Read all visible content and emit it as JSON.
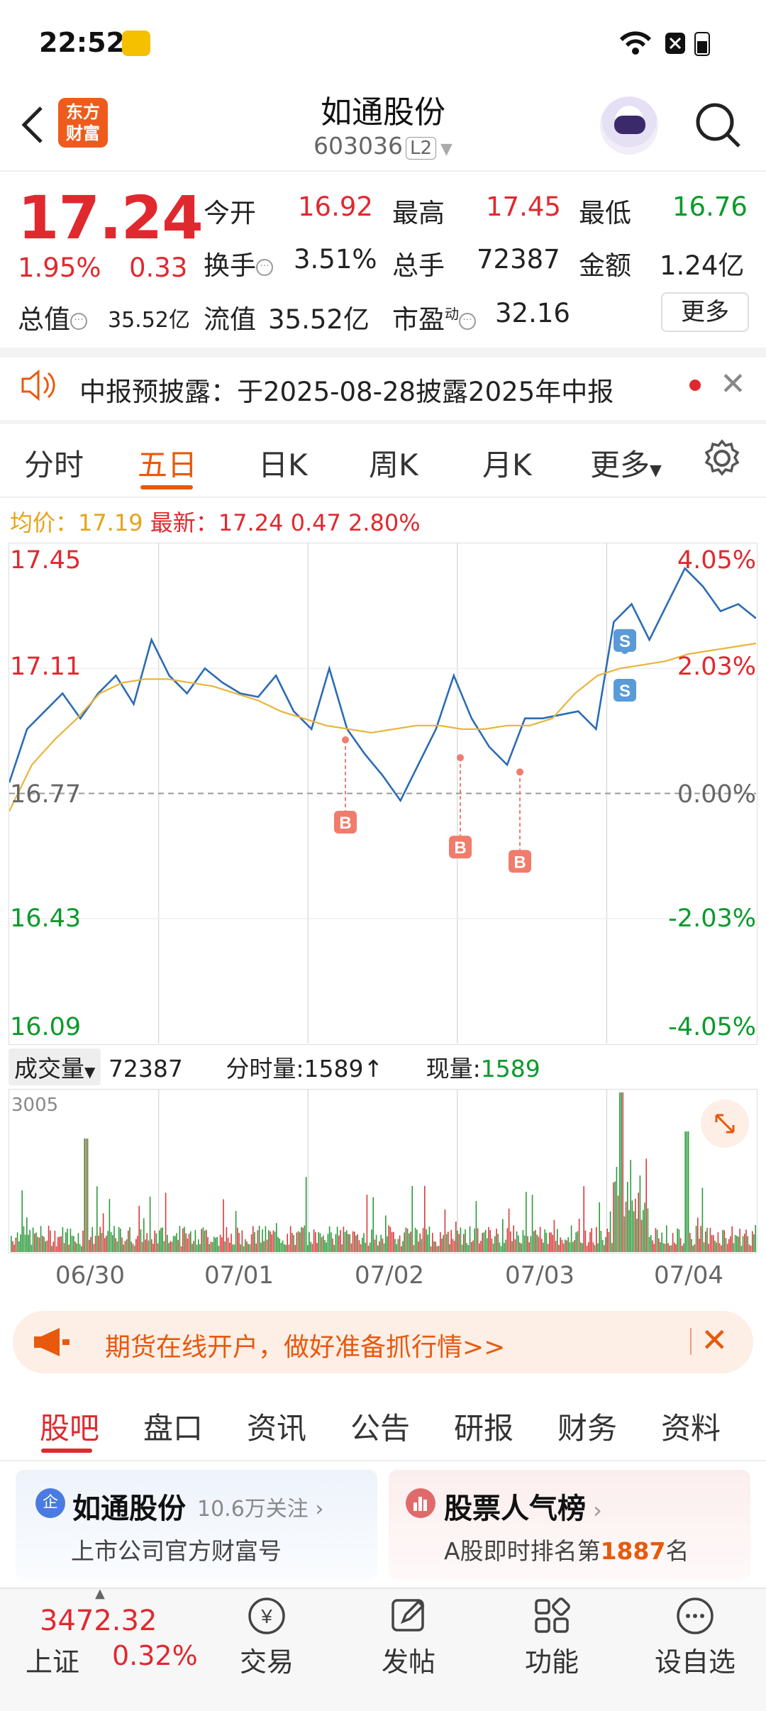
{
  "status_bar": {
    "time": "22:52"
  },
  "header": {
    "logo_line1": "东方",
    "logo_line2": "财富",
    "stock_name": "如通股份",
    "stock_code": "603036",
    "level": "L2"
  },
  "quote": {
    "price": "17.24",
    "change_pct": "1.95%",
    "change_amt": "0.33",
    "rows": [
      [
        {
          "label": "今开",
          "value": "16.92",
          "color": "#e0292f"
        },
        {
          "label": "最高",
          "value": "17.45",
          "color": "#e0292f"
        },
        {
          "label": "最低",
          "value": "16.76",
          "color": "#0a9a2c"
        }
      ],
      [
        {
          "label": "换手",
          "value": "3.51%",
          "color": "#222"
        },
        {
          "label": "总手",
          "value": "72387",
          "color": "#222"
        },
        {
          "label": "金额",
          "value": "1.24亿",
          "color": "#222"
        }
      ]
    ],
    "total_cap_label": "总值",
    "total_cap": "35.52亿",
    "float_cap_label": "流值",
    "float_cap": "35.52亿",
    "pe_label": "市盈",
    "pe_sup": "动",
    "pe": "32.16",
    "more_label": "更多"
  },
  "notice": {
    "text": "中报预披露：于2025-08-28披露2025年中报"
  },
  "chart_tabs": [
    {
      "label": "分时",
      "active": false
    },
    {
      "label": "五日",
      "active": true
    },
    {
      "label": "日K",
      "active": false
    },
    {
      "label": "周K",
      "active": false
    },
    {
      "label": "月K",
      "active": false
    },
    {
      "label": "更多",
      "active": false
    }
  ],
  "chart_info": {
    "avg_label": "均价：",
    "avg_value": "17.19",
    "latest_label": "最新：",
    "latest_value": "17.24",
    "latest_change": "0.47",
    "latest_pct": "2.80%"
  },
  "chart_data": {
    "type": "line",
    "x": [
      "06/30",
      "07/01",
      "07/02",
      "07/03",
      "07/04"
    ],
    "ylim": [
      16.09,
      17.45
    ],
    "y_ticks_left": [
      "17.45",
      "17.11",
      "16.77",
      "16.43",
      "16.09"
    ],
    "y_ticks_right": [
      "4.05%",
      "2.03%",
      "0.00%",
      "-2.03%",
      "-4.05%"
    ],
    "series": [
      {
        "values": [
          16.8,
          16.95,
          17.0,
          17.05,
          16.98,
          17.05,
          17.1,
          17.02,
          17.2,
          17.1,
          17.05,
          17.12,
          17.08,
          17.05,
          17.04,
          17.1,
          17.0,
          16.95,
          17.12,
          16.95,
          16.88,
          16.82,
          16.75,
          16.85,
          16.95,
          17.1,
          16.98,
          16.9,
          16.85,
          16.98,
          16.98,
          16.99,
          17.0,
          16.95,
          17.25,
          17.3,
          17.2,
          17.3,
          17.4,
          17.35,
          17.28,
          17.3,
          17.26
        ]
      },
      {
        "values": [
          16.72,
          16.85,
          16.92,
          16.98,
          17.05,
          17.08,
          17.09,
          17.09,
          17.08,
          17.07,
          17.05,
          17.03,
          17.0,
          16.98,
          16.96,
          16.95,
          16.94,
          16.95,
          16.96,
          16.96,
          16.95,
          16.95,
          16.96,
          16.96,
          16.98,
          17.05,
          17.1,
          17.12,
          17.13,
          17.14,
          17.16,
          17.17,
          17.18,
          17.19
        ]
      }
    ],
    "markers": [
      {
        "label": "B",
        "price": 16.92
      },
      {
        "label": "B",
        "price": 16.87
      },
      {
        "label": "B",
        "price": 16.83
      },
      {
        "label": "S",
        "price": 17.17
      },
      {
        "label": "S",
        "price": 17.22
      }
    ]
  },
  "volume": {
    "label": "成交量",
    "total": "72387",
    "tick_label": "分时量:1589↑",
    "now_label": "现量:",
    "now_value": "1589",
    "max_label": "3005"
  },
  "ad": {
    "text": "期货在线开户，做好准备抓行情>>"
  },
  "content_tabs": [
    {
      "label": "股吧",
      "active": true
    },
    {
      "label": "盘口",
      "active": false
    },
    {
      "label": "资讯",
      "active": false
    },
    {
      "label": "公告",
      "active": false
    },
    {
      "label": "研报",
      "active": false
    },
    {
      "label": "财务",
      "active": false
    },
    {
      "label": "资料",
      "active": false
    }
  ],
  "cards": {
    "left": {
      "badge": "企",
      "title": "如通股份",
      "followers": "10.6万关注",
      "subtitle": "上市公司官方财富号"
    },
    "right": {
      "title": "股票人气榜",
      "sub_prefix": "A股即时排名第",
      "rank": "1887",
      "sub_suffix": "名"
    }
  },
  "bottom_nav": {
    "index_value": "3472.32",
    "index_name": "上证",
    "index_pct": "0.32%",
    "items": [
      {
        "label": "交易",
        "icon": "trade-icon"
      },
      {
        "label": "发帖",
        "icon": "post-icon"
      },
      {
        "label": "功能",
        "icon": "apps-icon"
      },
      {
        "label": "设自选",
        "icon": "add-watchlist-icon"
      }
    ]
  }
}
